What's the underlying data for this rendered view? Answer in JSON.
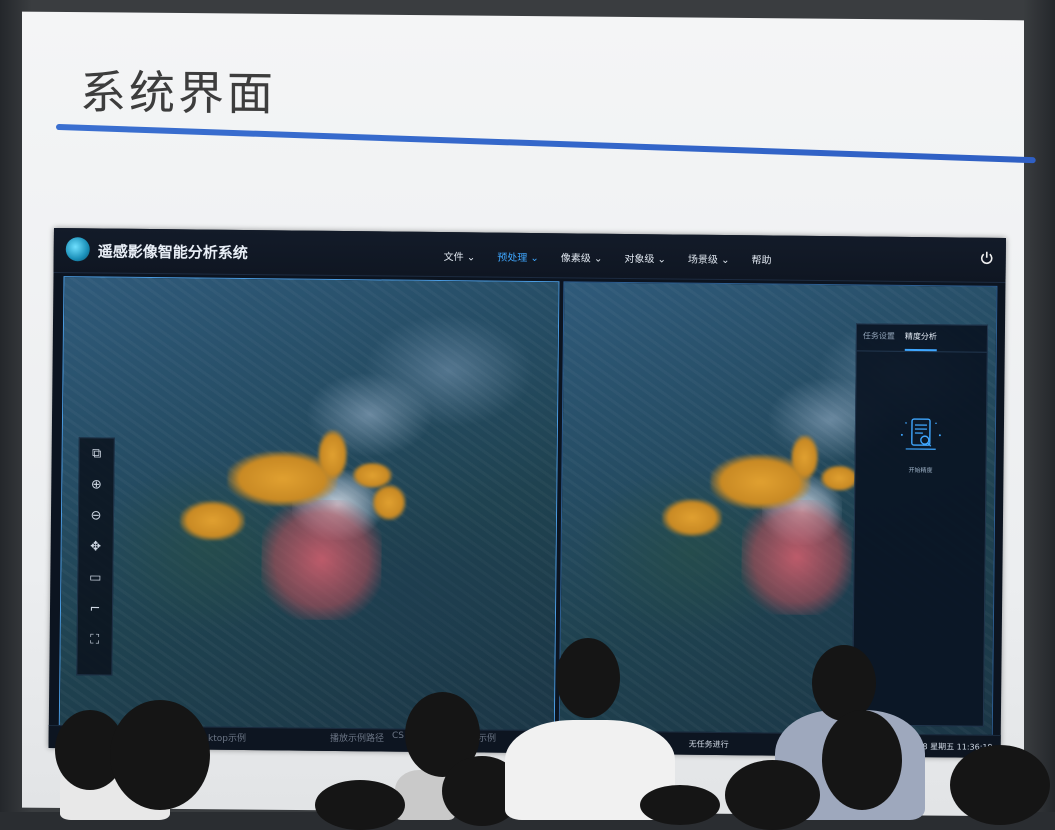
{
  "slide": {
    "title": "系统界面"
  },
  "app": {
    "title": "遥感影像智能分析系统",
    "menu": [
      {
        "label": "文件 ⌄",
        "active": false
      },
      {
        "label": "预处理 ⌄",
        "active": true
      },
      {
        "label": "像素级 ⌄",
        "active": false
      },
      {
        "label": "对象级 ⌄",
        "active": false
      },
      {
        "label": "场景级 ⌄",
        "active": false
      },
      {
        "label": "帮助",
        "active": false
      }
    ],
    "power_icon": "power-icon",
    "toolbar_icons": [
      "layers-icon",
      "zoom-in-icon",
      "zoom-out-icon",
      "pan-icon",
      "rectangle-select-icon",
      "polyline-icon",
      "fit-extent-icon"
    ],
    "panel": {
      "tabs": [
        {
          "label": "任务设置",
          "active": false
        },
        {
          "label": "精度分析",
          "active": true
        }
      ],
      "icon": "document-search-icon",
      "caption": "开始精度"
    },
    "status": {
      "center": "无任务进行",
      "datetime": "2023-12-08 星期五 11:36:19"
    }
  },
  "taskbar": {
    "left": "ktop示例",
    "mid1": "播放示例路径",
    "mid2": "CS",
    "mid3": "示例"
  },
  "colors": {
    "accent": "#3fa7ff",
    "title_rule": "#3a6fd0",
    "burn_orange": "#e0a030",
    "burn_red": "#d75f6e"
  }
}
